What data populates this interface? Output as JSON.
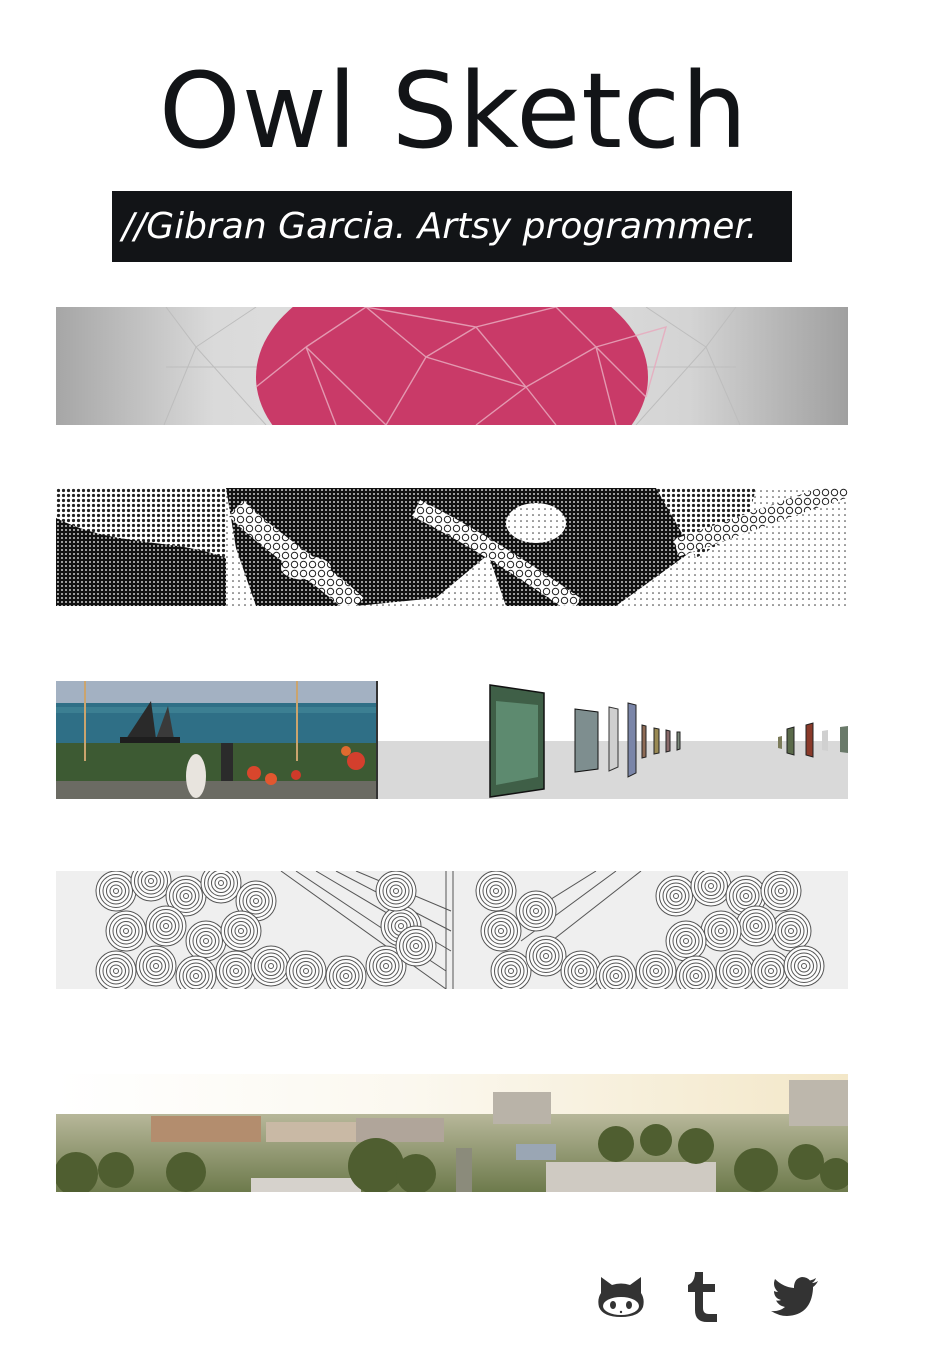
{
  "header": {
    "title": "Owl Sketch",
    "tagline": "//Gibran Garcia. Artsy programmer."
  },
  "projects": [
    {
      "icon": "polyhedron-sphere-thumbnail"
    },
    {
      "icon": "halftone-dots-thumbnail"
    },
    {
      "icon": "3d-gallery-thumbnail"
    },
    {
      "icon": "concentric-circles-thumbnail"
    },
    {
      "icon": "city-skyline-thumbnail"
    }
  ],
  "social": {
    "github": {
      "icon": "github-octocat-icon"
    },
    "tumblr": {
      "icon": "tumblr-icon"
    },
    "twitter": {
      "icon": "twitter-bird-icon"
    }
  },
  "colors": {
    "ink": "#121417",
    "pink": "#c93a68",
    "gray": "#aaaaaa",
    "icon": "#333333"
  }
}
